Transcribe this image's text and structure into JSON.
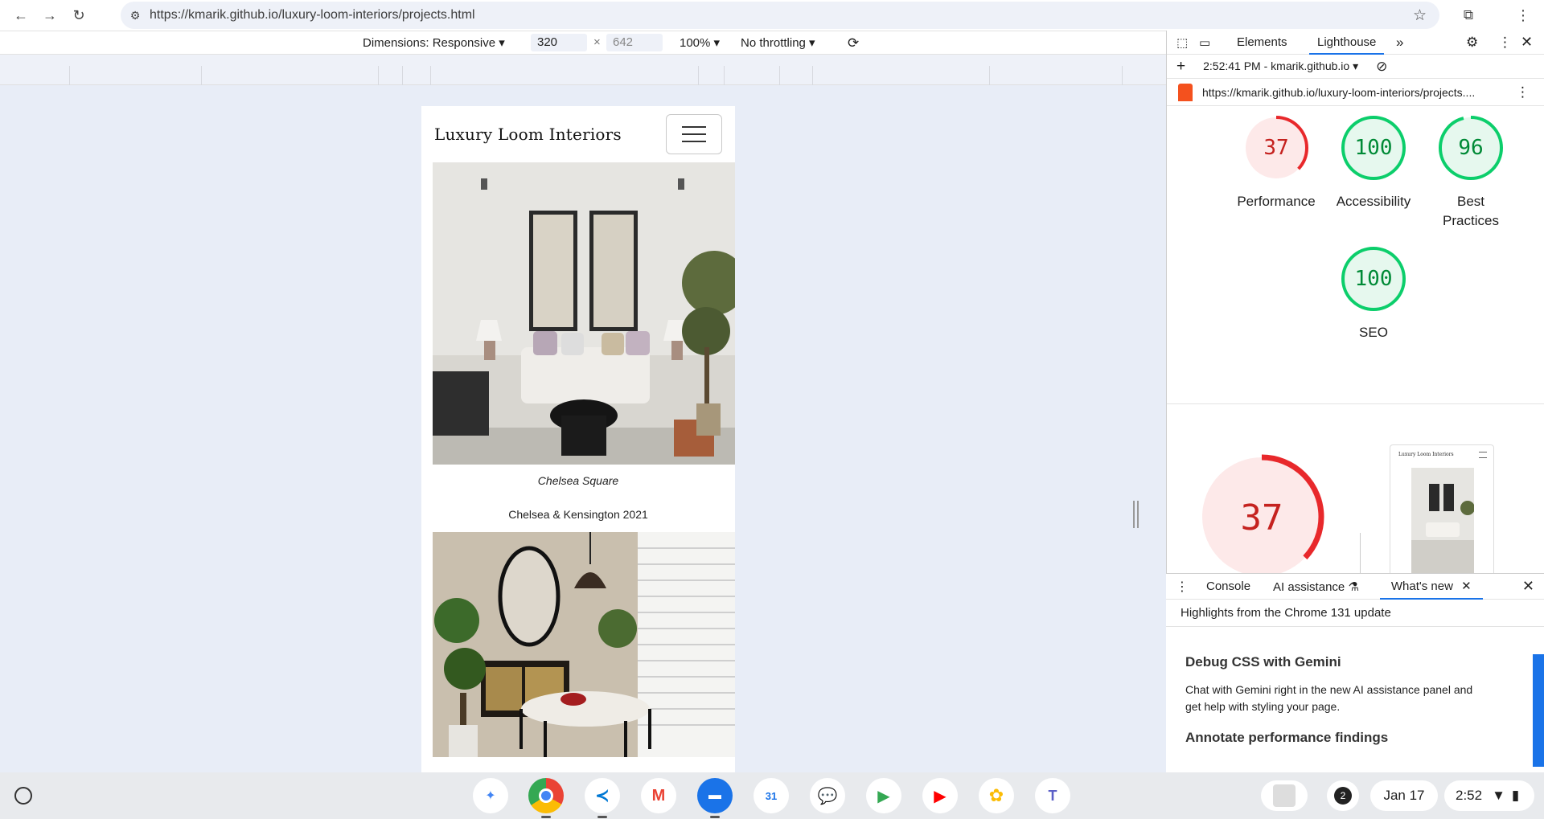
{
  "browser": {
    "url": "https://kmarik.github.io/luxury-loom-interiors/projects.html",
    "back_icon": "arrow-left-icon",
    "forward_icon": "arrow-right-icon",
    "reload_icon": "reload-icon"
  },
  "device_toolbar": {
    "dimensions_label": "Dimensions: Responsive",
    "width": "320",
    "height": "642",
    "times": "×",
    "zoom": "100%",
    "throttling": "No throttling"
  },
  "site": {
    "logo": "Luxury Loom Interiors",
    "project1_caption": "Chelsea Square",
    "project1_sub": "Chelsea & Kensington 2021"
  },
  "devtools": {
    "tabs": [
      "Elements",
      "Lighthouse"
    ],
    "more": "»",
    "report_time": "2:52:41 PM - kmarik.github.io",
    "report_url": "https://kmarik.github.io/luxury-loom-interiors/projects....",
    "scores": [
      {
        "label": "Performance",
        "value": 37,
        "color": "#e8282b",
        "bg": "#fde9e9"
      },
      {
        "label": "Accessibility",
        "value": 100,
        "color": "#0cce6b",
        "bg": "#e6f8ee"
      },
      {
        "label": "Best Practices",
        "value": 96,
        "color": "#0cce6b",
        "bg": "#e6f8ee"
      },
      {
        "label": "SEO",
        "value": 100,
        "color": "#0cce6b",
        "bg": "#e6f8ee"
      }
    ],
    "big_score": 37,
    "thumb_logo": "Luxury Loom Interiors"
  },
  "drawer": {
    "tabs": [
      "Console",
      "AI assistance",
      "What's new"
    ],
    "highlight": "Highlights from the Chrome 131 update",
    "heading1": "Debug CSS with Gemini",
    "para1": "Chat with Gemini right in the new AI assistance panel and get help with styling your page.",
    "heading2": "Annotate performance findings"
  },
  "taskbar": {
    "notification_count": "2",
    "date": "Jan 17",
    "time": "2:52",
    "calendar_day": "31"
  }
}
